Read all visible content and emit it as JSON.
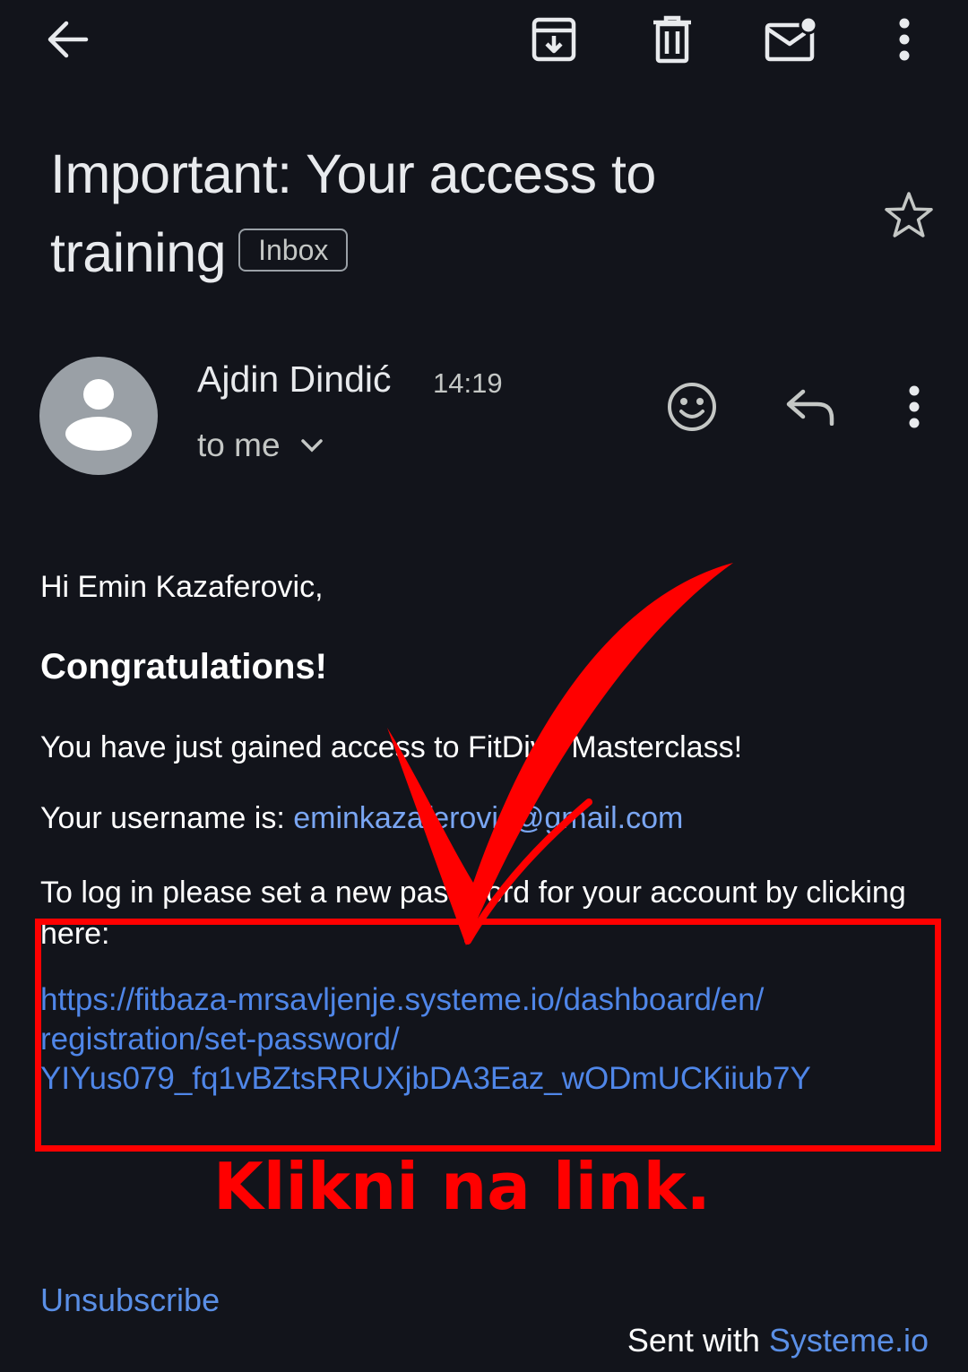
{
  "toolbar": {
    "back_icon": "arrow-left-icon",
    "archive_icon": "archive-icon",
    "delete_icon": "trash-icon",
    "unread_icon": "mark-unread-icon",
    "more_icon": "more-vertical-icon"
  },
  "email": {
    "subject": "Important: Your access to training",
    "label": "Inbox",
    "star_icon": "star-outline-icon"
  },
  "sender": {
    "name": "Ajdin Dindić",
    "time": "14:19",
    "recipient": "to me",
    "avatar_icon": "person-avatar-icon",
    "emoji_icon": "emoji-react-icon",
    "reply_icon": "reply-icon",
    "more_icon": "more-vertical-icon"
  },
  "body": {
    "greeting": "Hi Emin Kazaferovic,",
    "congrats": "Congratulations!",
    "access_line": "You have just gained access to FitDiva Masterclass!",
    "username_prefix": "Your username is: ",
    "username": "eminkazaferovic@gmail.com",
    "password_line": "To log in please set a new password for your account by clicking here:",
    "reset_link_lines": [
      "https://fitbaza-mrsavljenje.systeme.io/dashboard/en/",
      "registration/set-password/",
      "YIYus079_fq1vBZtsRRUXjbDA3Eaz_wODmUCKiiub7Y"
    ]
  },
  "annotation": {
    "text": "Klikni na link.",
    "color": "#ff0000"
  },
  "footer": {
    "unsubscribe": "Unsubscribe",
    "sent_with_prefix": "Sent with ",
    "sent_with_link": "Systeme.io"
  },
  "colors": {
    "background": "#12141b",
    "link": "#4f86e8",
    "text": "#ffffff"
  }
}
